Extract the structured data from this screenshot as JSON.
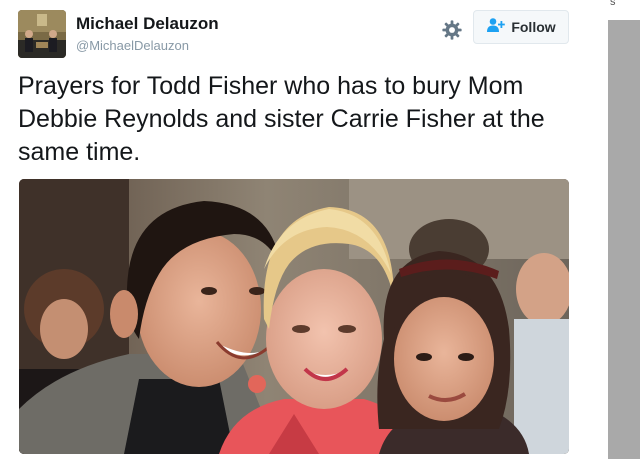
{
  "tweet": {
    "author_name": "Michael Delauzon",
    "author_handle": "@MichaelDelauzon",
    "follow_label": "Follow",
    "text": "Prayers for Todd Fisher who has to bury Mom Debbie Reynolds and sister Carrie Fisher at the same time.",
    "icons": {
      "settings": "gear-icon",
      "follow": "add-person-icon"
    },
    "colors": {
      "follow_icon": "#1da1f2",
      "name": "#14171a",
      "handle": "#8899a6"
    }
  },
  "right_rail": {
    "glyph": "s"
  }
}
